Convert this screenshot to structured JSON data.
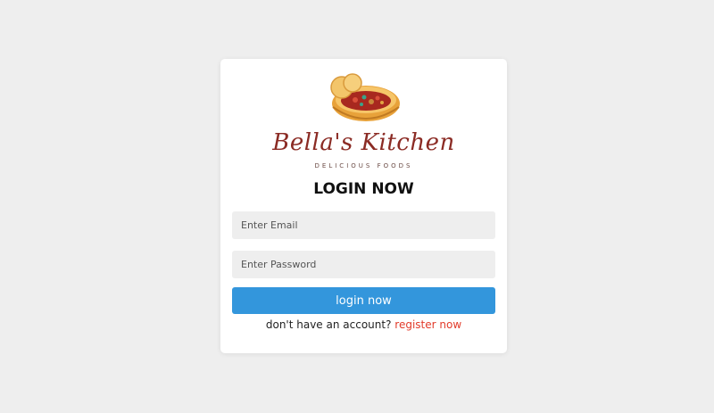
{
  "brand": {
    "name": "Bella's Kitchen",
    "tagline": "DELICIOUS FOODS",
    "logo_icon": "food-bowl-icon"
  },
  "form": {
    "title": "LOGIN NOW",
    "email_placeholder": "Enter Email",
    "password_placeholder": "Enter Password",
    "submit_label": "login now",
    "footer_text": "don't have an account?",
    "register_link": "register now"
  },
  "colors": {
    "background": "#eeeeee",
    "button": "#3396dc",
    "link": "#e23b2a",
    "brand": "#8b2b24"
  }
}
